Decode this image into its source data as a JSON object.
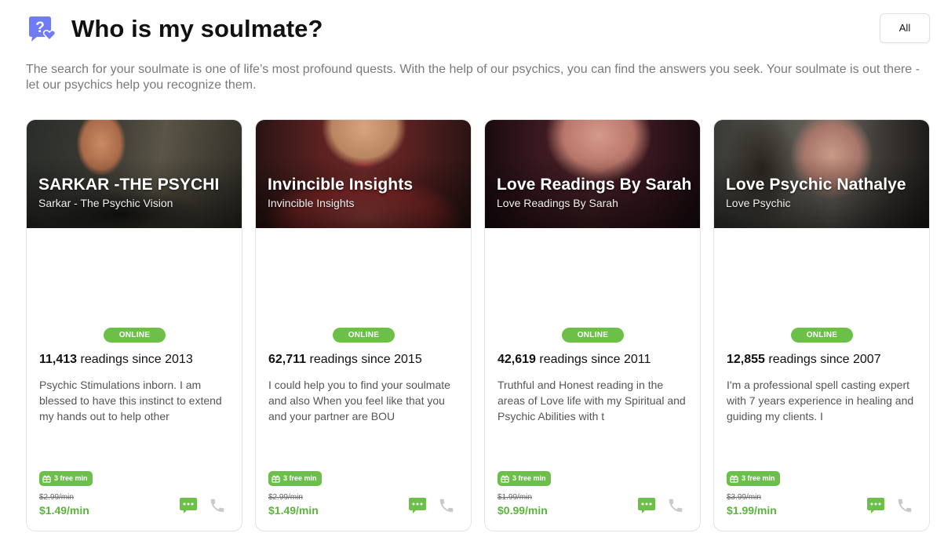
{
  "header": {
    "title": "Who is my soulmate?",
    "icon": "question-heart-icon",
    "all_button": "All"
  },
  "intro": "The search for your soulmate is one of life’s most profound quests. With the help of our psychics, you can find the answers you seek. Your soulmate is out there - let our psychics help you recognize them.",
  "colors": {
    "accent_green": "#6cc04a",
    "price_green": "#5bb53c",
    "icon_purple": "#6f7cf5"
  },
  "cards": [
    {
      "name": "SARKAR -THE PSYCHI",
      "subtitle": "Sarkar - The Psychic Vision",
      "status": "ONLINE",
      "readings_count": "11,413",
      "readings_suffix": "readings since 2013",
      "description": "Psychic Stimulations inborn. I am blessed to have this instinct to extend my hands out to help other",
      "free_badge": "3 free min",
      "old_price": "$2.99/min",
      "new_price": "$1.49/min"
    },
    {
      "name": "Invincible Insights",
      "subtitle": "Invincible Insights",
      "status": "ONLINE",
      "readings_count": "62,711",
      "readings_suffix": "readings since 2015",
      "description": "I could help you to find your soulmate and also When you feel like that you and your partner are BOU",
      "free_badge": "3 free min",
      "old_price": "$2.99/min",
      "new_price": "$1.49/min"
    },
    {
      "name": "Love Readings By Sarah",
      "subtitle": "Love Readings By Sarah",
      "status": "ONLINE",
      "readings_count": "42,619",
      "readings_suffix": "readings since 2011",
      "description": "Truthful and Honest reading in the areas of Love life with my Spiritual and Psychic Abilities with t",
      "free_badge": "3 free min",
      "old_price": "$1.99/min",
      "new_price": "$0.99/min"
    },
    {
      "name": "Love Psychic Nathalye",
      "subtitle": "Love Psychic",
      "status": "ONLINE",
      "readings_count": "12,855",
      "readings_suffix": "readings since 2007",
      "description": "I'm a professional spell casting expert with 7 years experience in healing and guiding my clients. I",
      "free_badge": "3 free min",
      "old_price": "$3.99/min",
      "new_price": "$1.99/min"
    }
  ]
}
